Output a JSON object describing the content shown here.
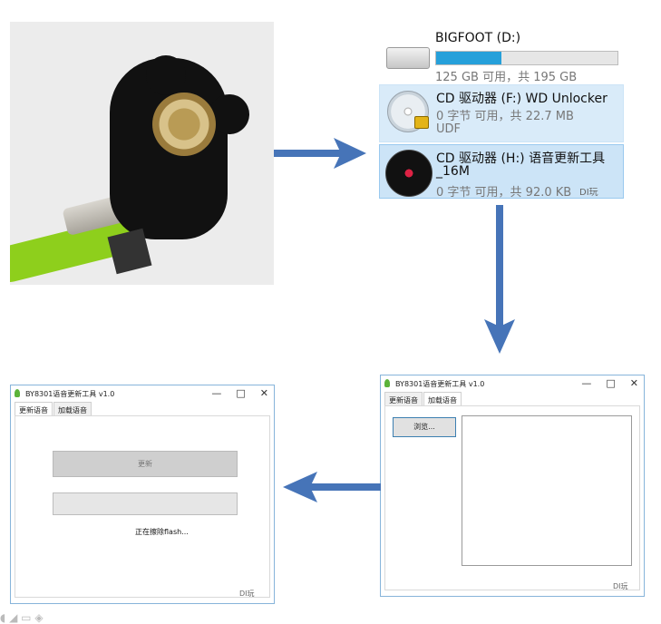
{
  "drives": [
    {
      "title": "BIGFOOT (D:)",
      "info": "125 GB 可用，共 195 GB",
      "used_fraction": 0.36,
      "icon": "hdd-icon"
    },
    {
      "title": "CD 驱动器 (F:) WD Unlocker",
      "info": "0 字节 可用，共 22.7 MB",
      "fs": "UDF",
      "icon": "cd-lock-icon"
    },
    {
      "title": "CD 驱动器 (H:) 语音更新工具",
      "title2": "_16M",
      "info": "0 字节 可用，共 92.0 KB",
      "icon": "vinyl-icon"
    }
  ],
  "watermark": "DI玩",
  "window_right": {
    "title": "BY8301语音更新工具 v1.0",
    "tabs": [
      "更新语音",
      "加载语音"
    ],
    "active_tab": 1,
    "browse_label": "浏览..."
  },
  "window_left": {
    "title": "BY8301语音更新工具 v1.0",
    "tabs": [
      "更新语音",
      "加载语音"
    ],
    "active_tab": 0,
    "update_label": "更新",
    "status": "正在擦除flash..."
  },
  "window_controls": [
    "—",
    "□",
    "✕"
  ],
  "colors": {
    "arrow": "#4674b8",
    "progress": "#26a0da",
    "selection": "#cce4f7"
  }
}
